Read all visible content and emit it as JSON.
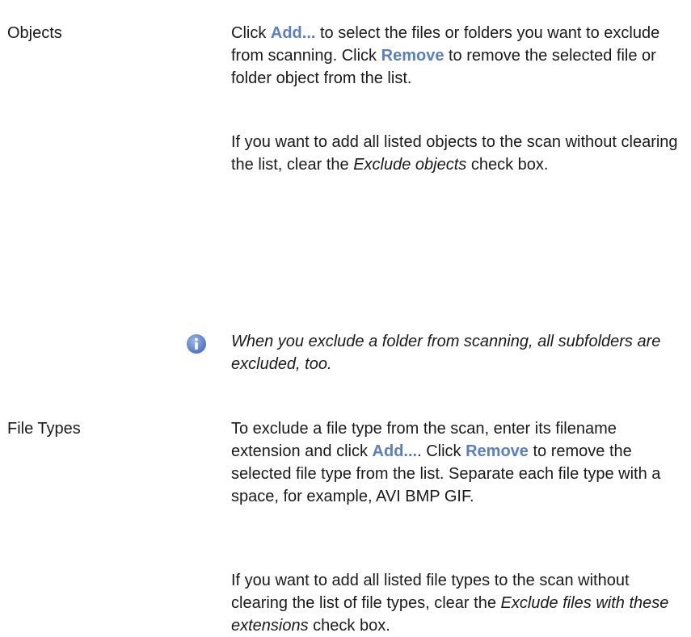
{
  "sections": [
    {
      "term": "Objects",
      "p1": {
        "t1": "Click ",
        "b1": "Add...",
        "t2": " to select the files or folders you want to exclude from scanning. Click ",
        "b2": "Remove",
        "t3": " to remove the selected file or folder object from the list."
      },
      "p2": {
        "t1": "If you want to add all listed objects to the scan without clearing the list, clear the ",
        "i1": "Exclude objects",
        "t2": " check box."
      },
      "note": {
        "icon": "info-icon",
        "text": "When you exclude a folder from scanning, all subfolders are excluded, too."
      }
    },
    {
      "term": "File Types",
      "p1": {
        "t1": "To exclude a file type from the scan, enter its filename extension and click ",
        "b1": "Add...",
        "t2": ". Click ",
        "b2": "Remove",
        "t3": " to remove the selected file type from the list. Separate each file type with a space, for example, AVI BMP GIF."
      },
      "p2": {
        "t1": "If you want to add all listed file types to the scan without clearing the list of file types, clear the ",
        "i1": "Exclude files with these extensions",
        "t2": " check box."
      }
    }
  ],
  "colors": {
    "ui_term": "#5a7fc0",
    "icon_fill": "#6b8fd6"
  }
}
